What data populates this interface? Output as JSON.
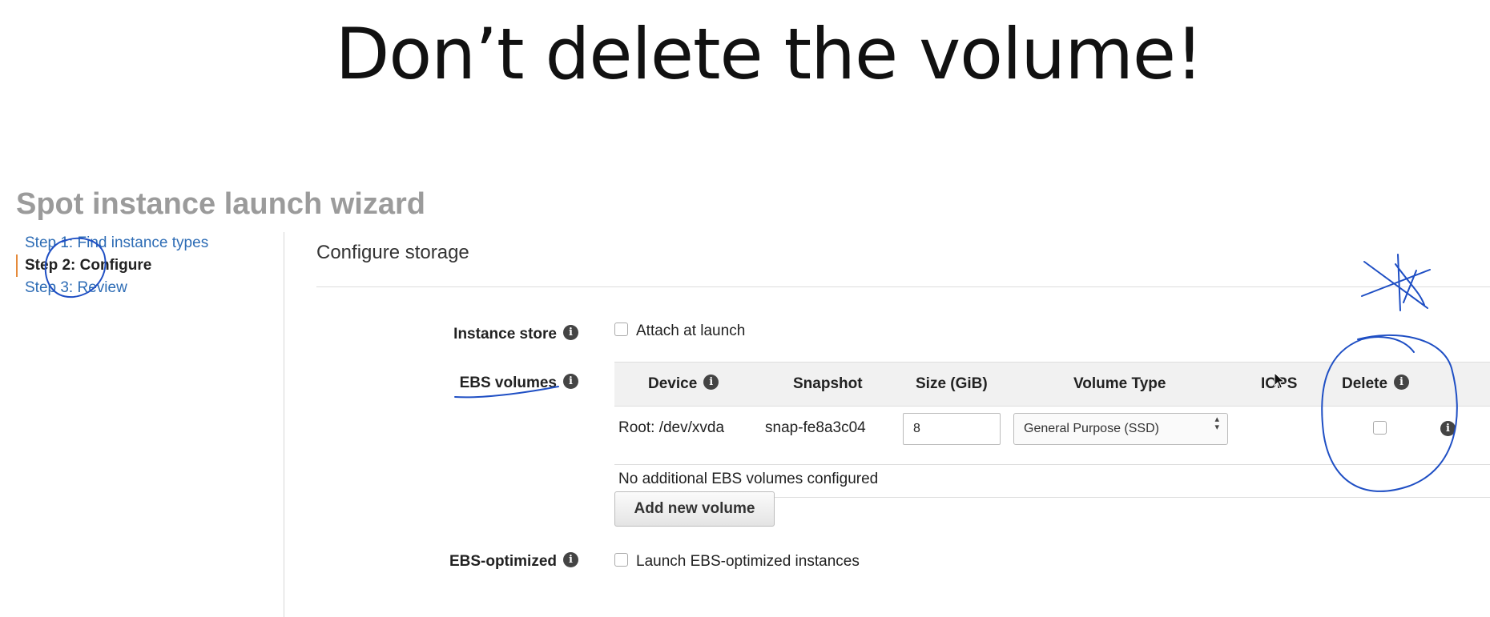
{
  "slide": {
    "title": "Don’t delete the volume!"
  },
  "wizard": {
    "title": "Spot instance launch wizard",
    "steps": [
      {
        "label": "Step 1: Find instance types",
        "state": "link"
      },
      {
        "label": "Step 2: Configure",
        "state": "active"
      },
      {
        "label": "Step 3: Review",
        "state": "link"
      }
    ]
  },
  "storage": {
    "section_title": "Configure storage",
    "instance_store": {
      "label": "Instance store",
      "checkbox_label": "Attach at launch",
      "checked": false
    },
    "ebs_volumes": {
      "label": "EBS volumes",
      "columns": {
        "device": "Device",
        "snapshot": "Snapshot",
        "size": "Size (GiB)",
        "volume_type": "Volume Type",
        "iops": "IOPS",
        "delete": "Delete"
      },
      "rows": [
        {
          "device": "Root: /dev/xvda",
          "snapshot": "snap-fe8a3c04",
          "size": "8",
          "volume_type": "General Purpose (SSD)",
          "iops": "",
          "delete_on_termination": false
        }
      ],
      "empty_message": "No additional EBS volumes configured",
      "add_button": "Add new volume"
    },
    "ebs_optimized": {
      "label": "EBS-optimized",
      "checkbox_label": "Launch EBS-optimized instances",
      "checked": false
    }
  },
  "icons": {
    "info": "info-icon",
    "checkbox": "checkbox-icon",
    "select": "select-arrows-icon",
    "cursor": "mouse-cursor-icon"
  },
  "colors": {
    "link": "#2d6cb5",
    "annotation_ink": "#1f4fc4",
    "active_step_marker": "#e58a3a",
    "wizard_title": "#9b9b9b"
  }
}
